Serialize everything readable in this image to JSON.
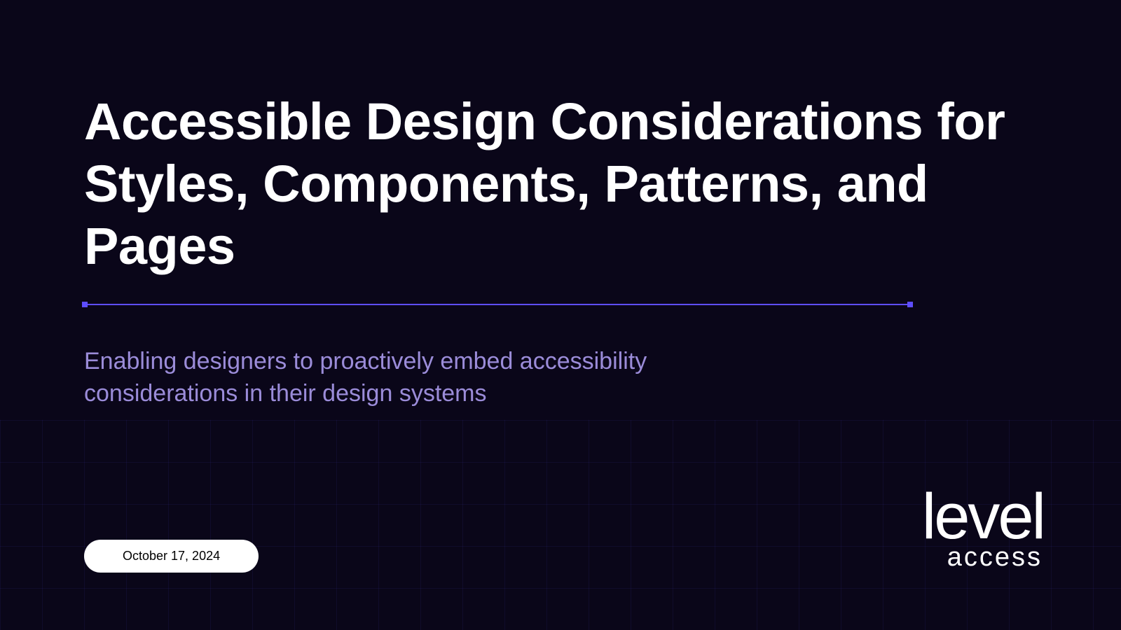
{
  "slide": {
    "title": "Accessible Design Considerations for Styles, Components, Patterns, and Pages",
    "subtitle": "Enabling designers to proactively embed accessibility considerations in their design systems",
    "date": "October 17, 2024"
  },
  "brand": {
    "logo_primary": "level",
    "logo_secondary": "access"
  },
  "colors": {
    "background": "#0a0619",
    "title": "#ffffff",
    "subtitle": "#9b8cd9",
    "accent": "#5e4dff"
  }
}
